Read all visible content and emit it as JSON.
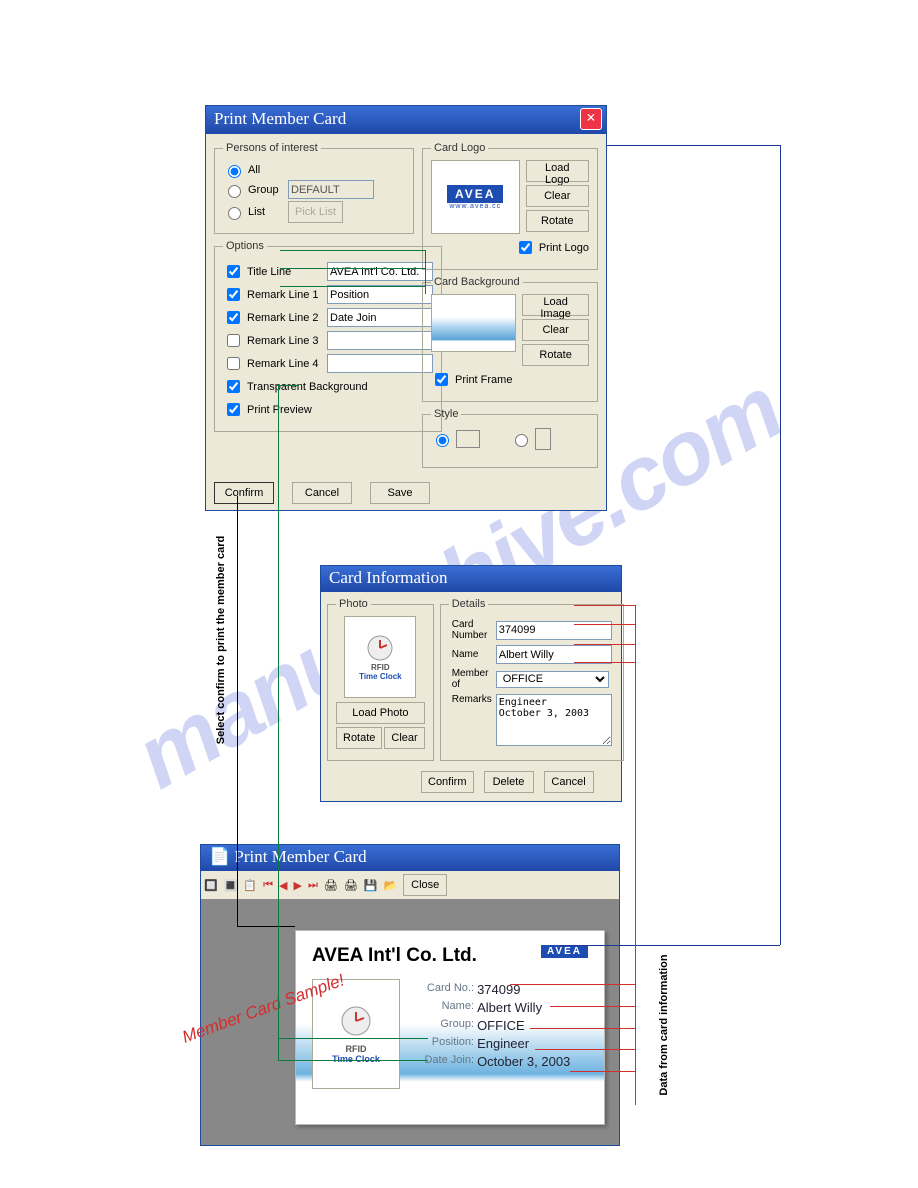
{
  "dlg1": {
    "title": "Print Member Card",
    "persons_legend": "Persons of interest",
    "all": "All",
    "group": "Group",
    "group_val": "DEFAULT",
    "list": "List",
    "picklist": "Pick List",
    "options_legend": "Options",
    "title_line": "Title Line",
    "title_line_val": "AVEA Int'l Co. Ltd.",
    "r1": "Remark Line 1",
    "r1v": "Position",
    "r2": "Remark Line 2",
    "r2v": "Date Join",
    "r3": "Remark Line 3",
    "r3v": "",
    "r4": "Remark Line 4",
    "r4v": "",
    "transp": "Transparent Background",
    "preview": "Print Preview",
    "cardlogo_legend": "Card Logo",
    "loadlogo": "Load Logo",
    "clear": "Clear",
    "rotate": "Rotate",
    "printlogo": "Print Logo",
    "cardbg_legend": "Card Background",
    "loadimg": "Load Image",
    "printframe": "Print Frame",
    "style_legend": "Style",
    "confirm": "Confirm",
    "cancel": "Cancel",
    "save": "Save",
    "logo_text": "AVEA",
    "logo_sub": "www.avea.cc"
  },
  "dlg2": {
    "title": "Card Information",
    "photo_legend": "Photo",
    "details_legend": "Details",
    "cardnum": "Card Number",
    "cardnum_v": "374099",
    "name": "Name",
    "name_v": "Albert Willy",
    "memberof": "Member of",
    "memberof_v": "OFFICE",
    "remarks": "Remarks",
    "remarks_v": "Engineer\nOctober 3, 2003",
    "photo_lbl1": "RFID",
    "photo_lbl2": "Time Clock",
    "loadphoto": "Load Photo",
    "rotate": "Rotate",
    "clear": "Clear",
    "confirm": "Confirm",
    "delete": "Delete",
    "cancel": "Cancel"
  },
  "dlg3": {
    "title": "Print Member Card",
    "close": "Close"
  },
  "card": {
    "title": "AVEA Int'l Co. Ltd.",
    "logo": "AVEA",
    "cardno_lbl": "Card No.:",
    "cardno": "374099",
    "name_lbl": "Name:",
    "name": "Albert Willy",
    "group_lbl": "Group:",
    "group": "OFFICE",
    "pos_lbl": "Position:",
    "pos": "Engineer",
    "date_lbl": "Date Join:",
    "date": "October 3, 2003",
    "photo_lbl1": "RFID",
    "photo_lbl2": "Time Clock"
  },
  "annotations": {
    "a1": "Select confirm to print the member card",
    "a2": "Member Card Sample!",
    "a3": "Data from card information"
  }
}
